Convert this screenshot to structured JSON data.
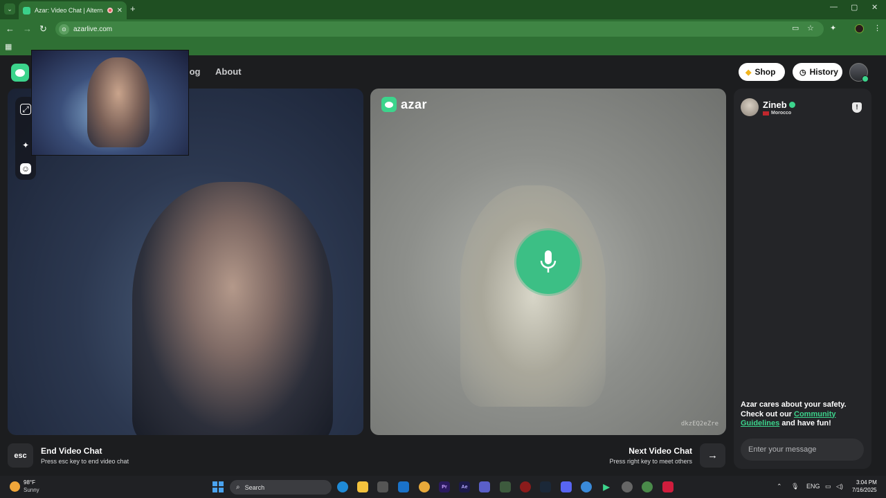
{
  "browser": {
    "tab_title": "Azar: Video Chat | Alternati",
    "tab_close": "✕",
    "new_tab": "+",
    "url": "azarlive.com",
    "window_controls": [
      "—",
      "▢",
      "✕"
    ]
  },
  "header": {
    "nav": [
      "log",
      "About"
    ],
    "shop_label": "Shop",
    "history_label": "History"
  },
  "mid_panel": {
    "brand": "azar",
    "watermark": "dkzEQ2eZre"
  },
  "chat": {
    "partner_name": "Zineb",
    "partner_country": "Morocco",
    "safety_line1": "Azar cares about your safety.",
    "safety_line2": "Check out our",
    "safety_link": "Community Guidelines",
    "safety_line3": "and have fun!",
    "input_placeholder": "Enter your message"
  },
  "bottom": {
    "esc_key": "esc",
    "end_title": "End Video Chat",
    "end_sub": "Press esc key to end video chat",
    "next_title": "Next Video Chat",
    "next_sub": "Press right key to meet others",
    "next_arrow": "→"
  },
  "taskbar": {
    "weather_temp": "98°F",
    "weather_cond": "Sunny",
    "search_label": "Search",
    "lang": "ENG",
    "time": "3:04 PM",
    "date": "7/16/2025"
  },
  "colors": {
    "accent": "#3cd48c",
    "chrome_green": "#2f7034",
    "page_bg": "#1c1d1f"
  },
  "icons": {
    "pip_toggle": "expand-icon",
    "effects": "sparkle-icon",
    "sticker": "smile-icon",
    "mic": "microphone-icon",
    "report": "shield-icon"
  }
}
